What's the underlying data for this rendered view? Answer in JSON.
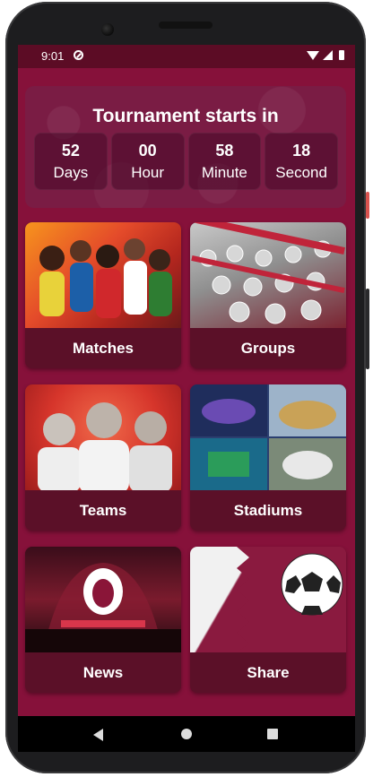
{
  "status_bar": {
    "time": "9:01"
  },
  "countdown": {
    "title": "Tournament starts in",
    "days": {
      "value": "52",
      "unit": "Days"
    },
    "hours": {
      "value": "00",
      "unit": "Hour"
    },
    "minutes": {
      "value": "58",
      "unit": "Minute"
    },
    "seconds": {
      "value": "18",
      "unit": "Second"
    }
  },
  "cards": [
    {
      "label": "Matches"
    },
    {
      "label": "Groups"
    },
    {
      "label": "Teams"
    },
    {
      "label": "Stadiums"
    },
    {
      "label": "News"
    },
    {
      "label": "Share"
    }
  ],
  "colors": {
    "background": "#86113a",
    "card": "#5b1028",
    "status_bar": "#5c0c25"
  }
}
